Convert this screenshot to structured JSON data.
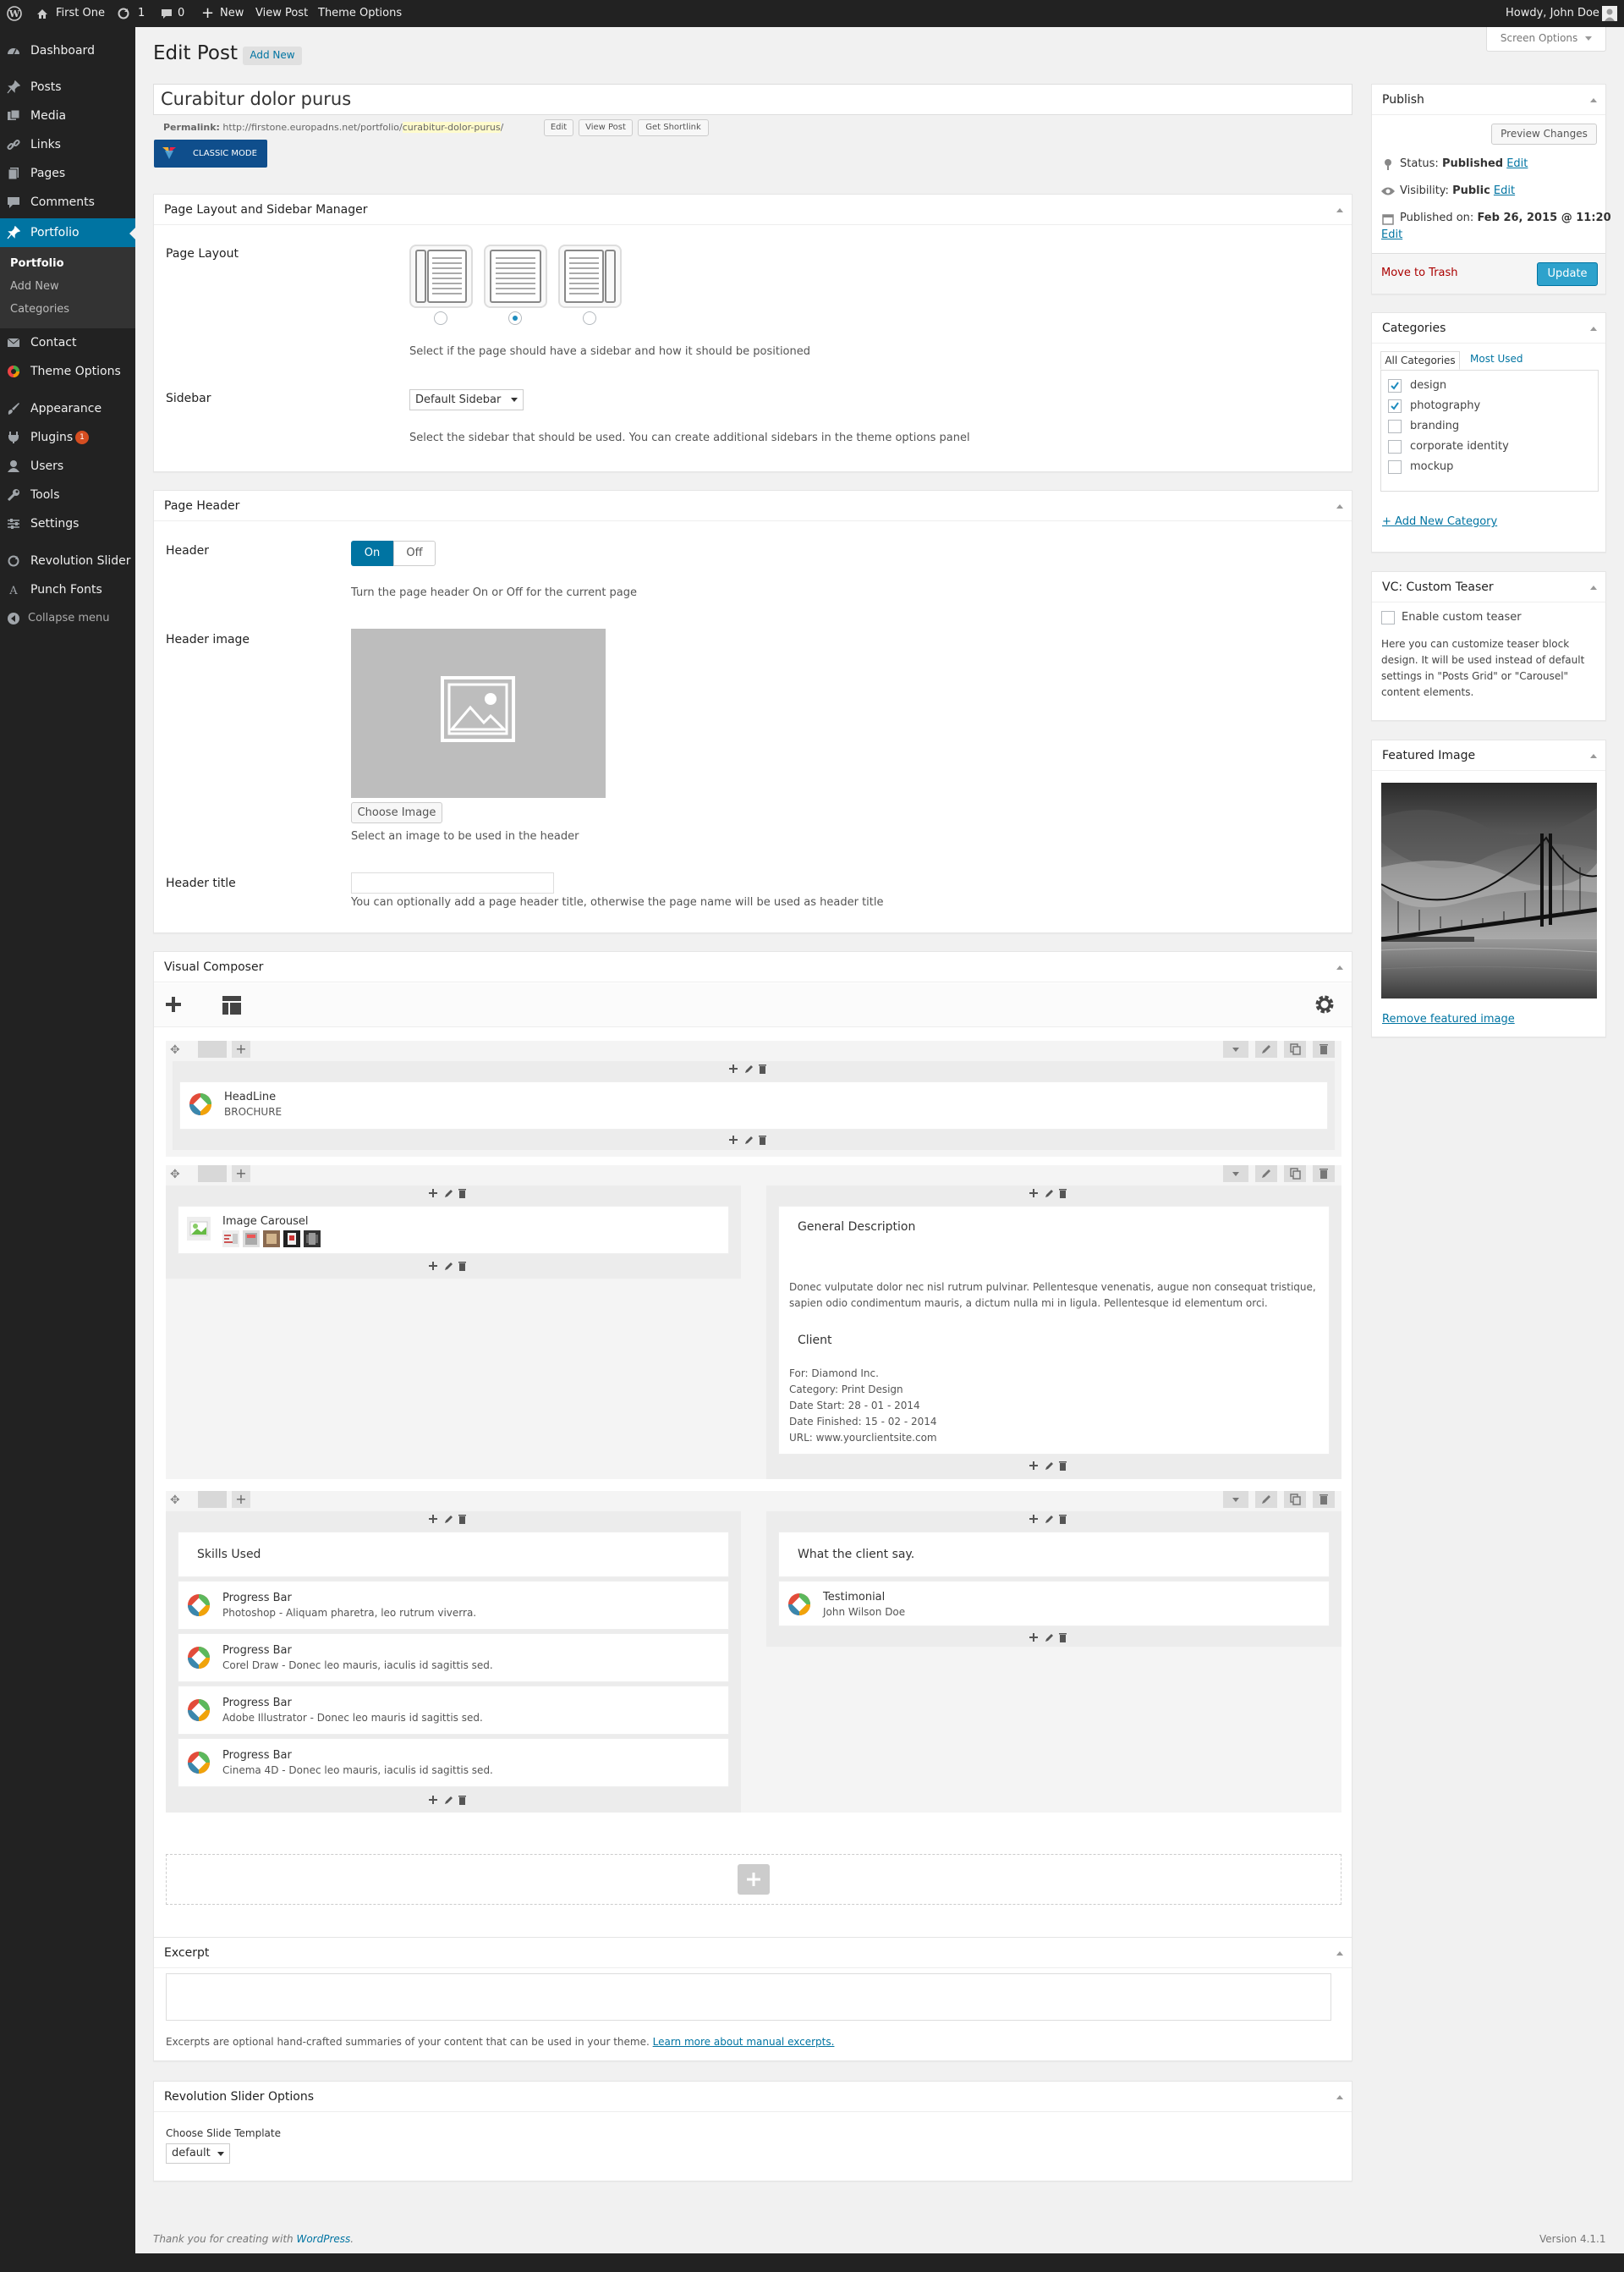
{
  "adminbar": {
    "site_name": "First One",
    "updates_count": "1",
    "comments_count": "0",
    "new_label": "New",
    "view_post": "View Post",
    "theme_options": "Theme Options",
    "howdy": "Howdy, John Doe"
  },
  "menu": {
    "items": [
      "Dashboard",
      "Posts",
      "Media",
      "Links",
      "Pages",
      "Comments",
      "Portfolio",
      "Contact",
      "Theme Options",
      "Appearance",
      "Plugins",
      "Users",
      "Tools",
      "Settings",
      "Revolution Slider",
      "Punch Fonts"
    ],
    "plugins_badge": "1",
    "collapse": "Collapse menu",
    "portfolio_sub": [
      "Portfolio",
      "Add New",
      "Categories"
    ]
  },
  "header": {
    "title": "Edit Post",
    "add_new": "Add New",
    "screen_options": "Screen Options"
  },
  "post": {
    "title": "Curabitur dolor purus",
    "permalink_label": "Permalink:",
    "permalink_base": "http://firstone.europadns.net/portfolio/",
    "permalink_slug": "curabitur-dolor-purus",
    "permalink_end": "/",
    "edit_btn": "Edit",
    "view_post_btn": "View Post",
    "shortlink_btn": "Get Shortlink",
    "classic_mode": "CLASSIC MODE"
  },
  "layout_box": {
    "title": "Page Layout and Sidebar Manager",
    "page_layout_label": "Page Layout",
    "page_layout_desc": "Select if the page should have a sidebar and how it should be positioned",
    "selected_layout": 2,
    "sidebar_label": "Sidebar",
    "sidebar_value": "Default Sidebar",
    "sidebar_desc": "Select the sidebar that should be used. You can create additional sidebars in the theme options panel"
  },
  "header_box": {
    "title": "Page Header",
    "header_label": "Header",
    "on": "On",
    "off": "Off",
    "header_desc": "Turn the page header On or Off for the current page",
    "image_label": "Header image",
    "choose_image": "Choose Image",
    "image_desc": "Select an image to be used in the header",
    "title_label": "Header title",
    "title_value": "",
    "title_desc": "You can optionally add a page header title, otherwise the page name will be used as header title"
  },
  "vc": {
    "title": "Visual Composer",
    "headline_name": "HeadLine",
    "headline_sub": "BROCHURE",
    "carousel_name": "Image Carousel",
    "general_title": "General Description",
    "general_text_1": "Donec vulputate dolor nec nisl rutrum pulvinar. Pellentesque venenatis, augue non consequat tristique,",
    "general_text_2": "sapien odio condimentum mauris, a dictum nulla mi in ligula. Pellentesque id elementum orci.",
    "client_title": "Client",
    "client_lines": [
      "For: Diamond Inc.",
      "Category: Print Design",
      "Date Start: 28 - 01 - 2014",
      "Date Finished: 15 - 02 - 2014",
      "URL: www.yourclientsite.com"
    ],
    "skills_title": "Skills Used",
    "progress": [
      {
        "name": "Progress Bar",
        "sub": "Photoshop - Aliquam pharetra, leo rutrum viverra."
      },
      {
        "name": "Progress Bar",
        "sub": "Corel Draw - Donec leo mauris, iaculis id sagittis sed."
      },
      {
        "name": "Progress Bar",
        "sub": "Adobe Illustrator - Donec leo mauris id sagittis sed."
      },
      {
        "name": "Progress Bar",
        "sub": "Cinema 4D - Donec leo mauris, iaculis id sagittis sed."
      }
    ],
    "client_say_title": "What the client say.",
    "testimonial_name": "Testimonial",
    "testimonial_sub": "John Wilson Doe"
  },
  "excerpt": {
    "title": "Excerpt",
    "desc": "Excerpts are optional hand-crafted summaries of your content that can be used in your theme.",
    "link": "Learn more about manual excerpts."
  },
  "revslider": {
    "title": "Revolution Slider Options",
    "label": "Choose Slide Template",
    "value": "default"
  },
  "publish": {
    "title": "Publish",
    "preview": "Preview Changes",
    "status_label": "Status:",
    "status_value": "Published",
    "visibility_label": "Visibility:",
    "visibility_value": "Public",
    "published_label": "Published on:",
    "published_value": "Feb 26, 2015 @ 11:20",
    "edit": "Edit",
    "trash": "Move to Trash",
    "update": "Update"
  },
  "categories": {
    "title": "Categories",
    "tab_all": "All Categories",
    "tab_most": "Most Used",
    "items": [
      {
        "label": "design",
        "checked": true
      },
      {
        "label": "photography",
        "checked": true
      },
      {
        "label": "branding",
        "checked": false
      },
      {
        "label": "corporate identity",
        "checked": false
      },
      {
        "label": "mockup",
        "checked": false
      }
    ],
    "add_new": "+ Add New Category"
  },
  "teaser": {
    "title": "VC: Custom Teaser",
    "enable": "Enable custom teaser",
    "desc": [
      "Here you can customize teaser block",
      "design. It will be used instead of default",
      "settings in \"Posts Grid\" or \"Carousel\"",
      "content elements."
    ]
  },
  "featured": {
    "title": "Featured Image",
    "remove": "Remove featured image"
  },
  "footer": {
    "thanks": "Thank you for creating with",
    "wordpress": "WordPress",
    "version": "Version 4.1.1"
  },
  "colors": {
    "accent": "#0074a2",
    "menu_bg": "#222222",
    "update_btn": "#2ea2cc",
    "trash": "#a00000"
  }
}
